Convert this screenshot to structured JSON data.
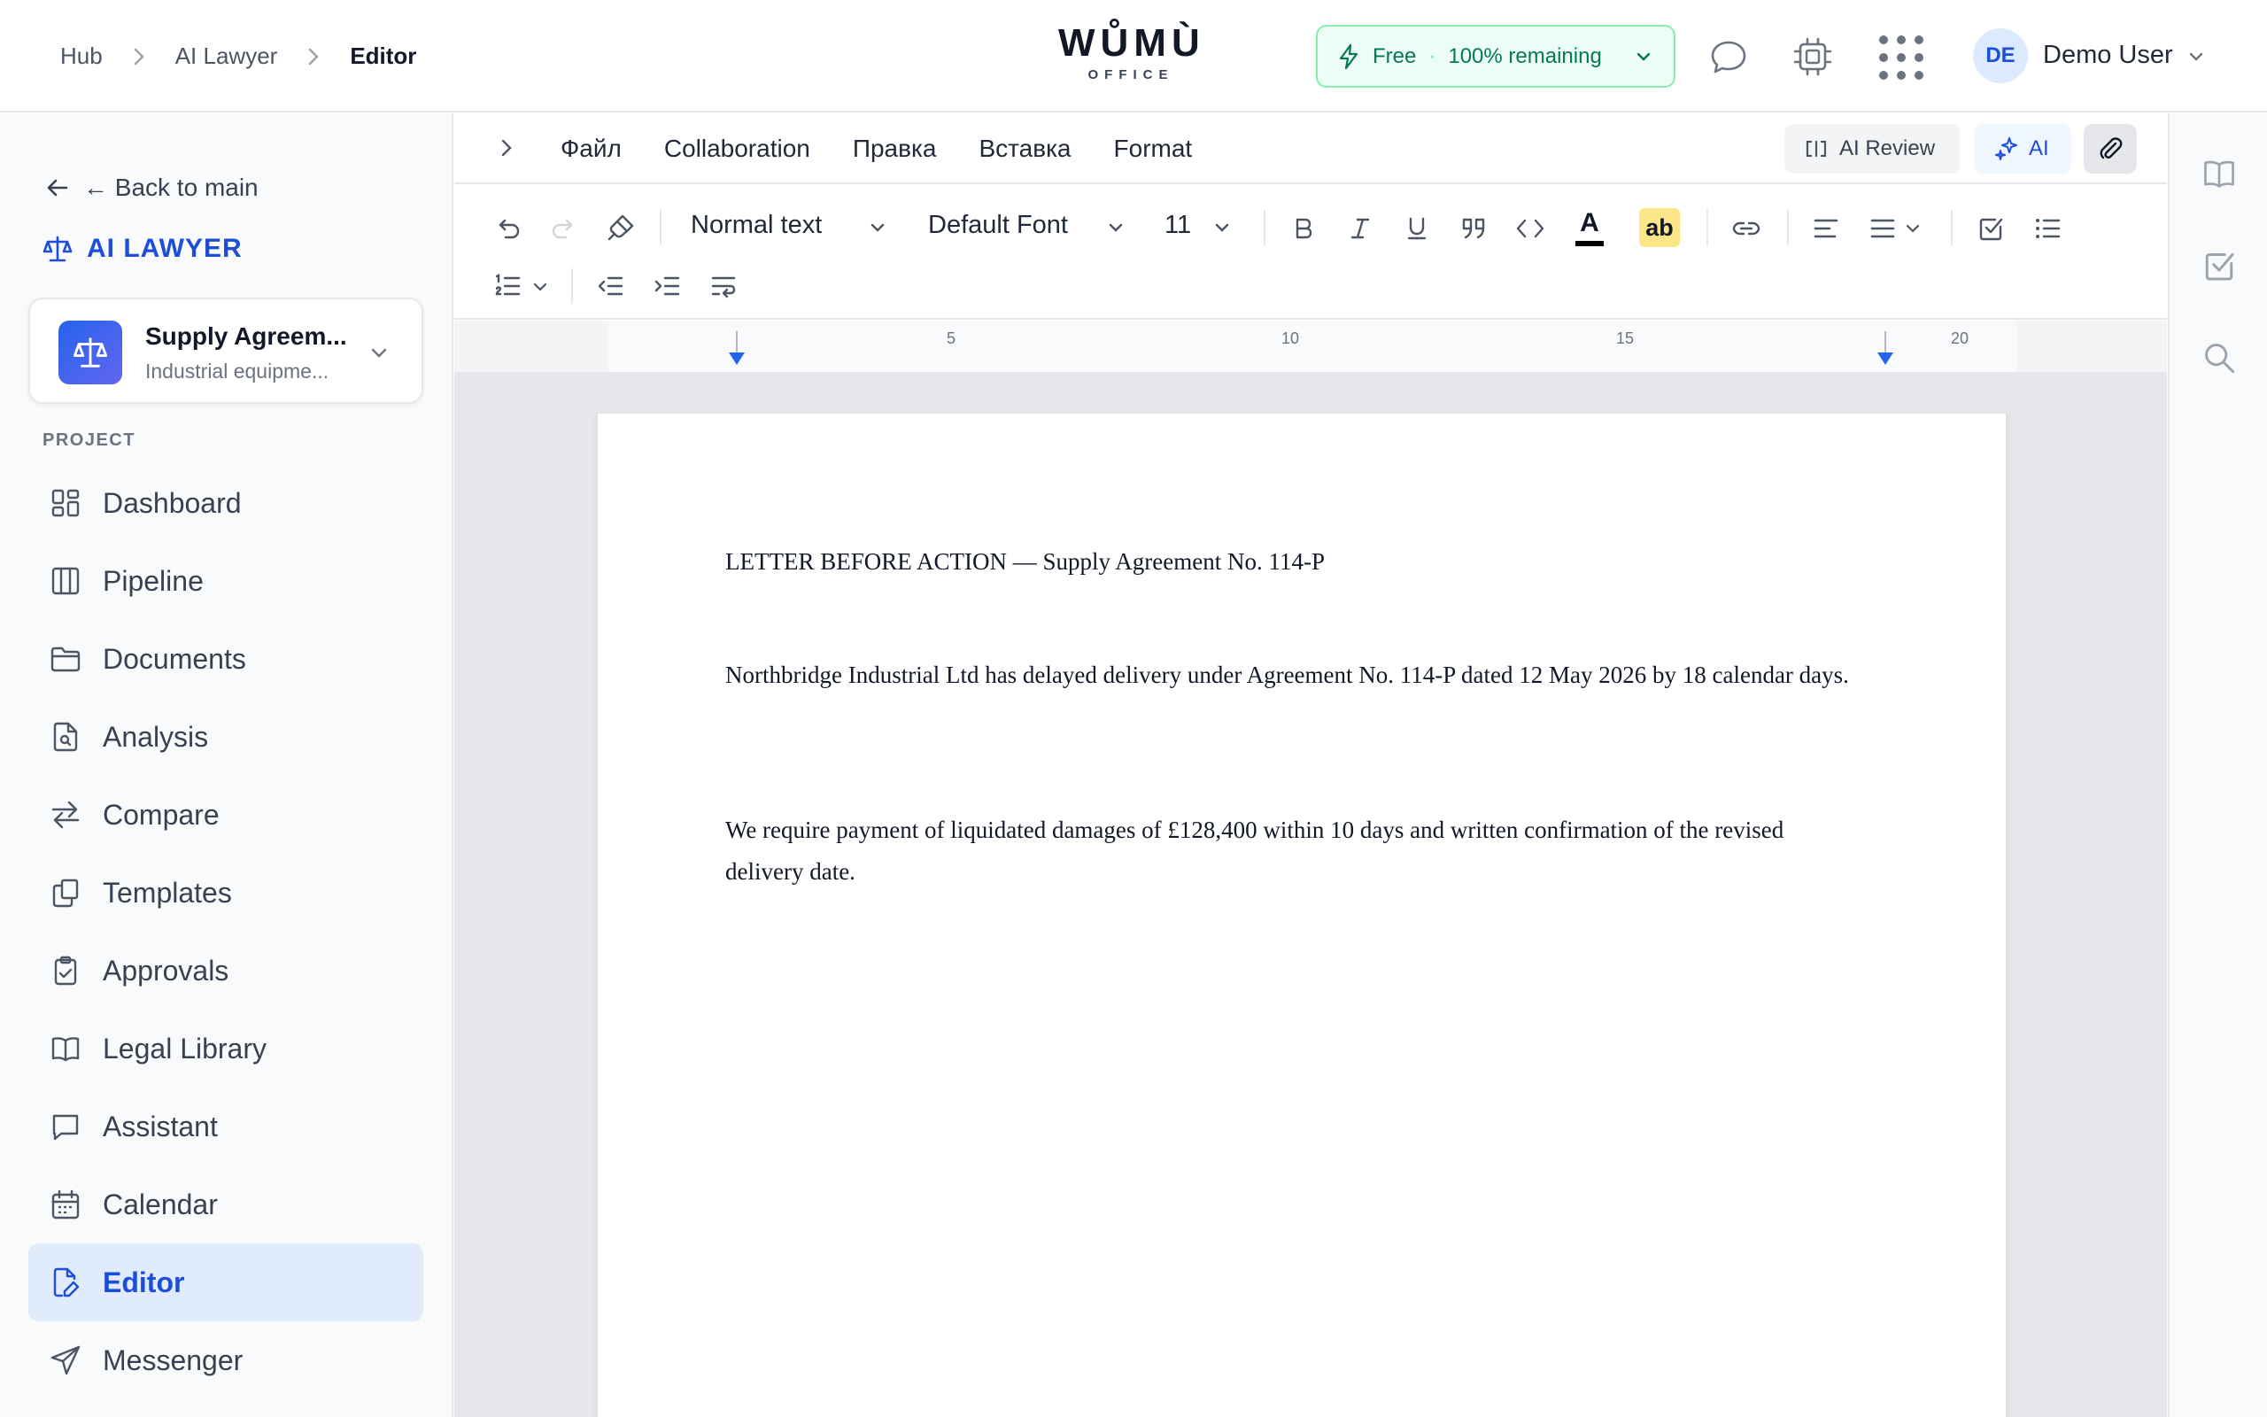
{
  "header": {
    "breadcrumbs": [
      "Hub",
      "AI Lawyer",
      "Editor"
    ],
    "logo": {
      "word": "WŮMÙ",
      "sub": "OFFICE"
    },
    "plan": {
      "name": "Free",
      "remaining": "100% remaining"
    },
    "user": {
      "initials": "DE",
      "name": "Demo User"
    }
  },
  "sidebar": {
    "back_label": "← Back to main",
    "brand": "AI LAWYER",
    "project": {
      "name": "Supply Agreem...",
      "description": "Industrial equipme..."
    },
    "section_label": "PROJECT",
    "items": [
      {
        "label": "Dashboard",
        "icon": "dashboard-icon"
      },
      {
        "label": "Pipeline",
        "icon": "pipeline-icon"
      },
      {
        "label": "Documents",
        "icon": "folder-icon"
      },
      {
        "label": "Analysis",
        "icon": "file-search-icon"
      },
      {
        "label": "Compare",
        "icon": "compare-arrows-icon"
      },
      {
        "label": "Templates",
        "icon": "templates-icon"
      },
      {
        "label": "Approvals",
        "icon": "clipboard-check-icon"
      },
      {
        "label": "Legal Library",
        "icon": "book-icon"
      },
      {
        "label": "Assistant",
        "icon": "chat-icon"
      },
      {
        "label": "Calendar",
        "icon": "calendar-icon"
      },
      {
        "label": "Editor",
        "icon": "edit-file-icon",
        "active": true
      },
      {
        "label": "Messenger",
        "icon": "send-icon"
      }
    ]
  },
  "menubar": {
    "menus": [
      "Файл",
      "Collaboration",
      "Правка",
      "Вставка",
      "Format"
    ],
    "ai_review": "AI Review",
    "ai": "AI"
  },
  "toolbar": {
    "block_type": "Normal text",
    "font": "Default Font",
    "font_size": "11",
    "highlight_label": "ab",
    "text_color_label": "A"
  },
  "ruler": {
    "ticks": [
      "5",
      "10",
      "15",
      "20"
    ]
  },
  "document": {
    "paragraphs": [
      "LETTER BEFORE ACTION — Supply Agreement No. 114-P",
      "Northbridge Industrial Ltd has delayed delivery under Agreement No. 114-P dated 12 May 2026 by 18 calendar days.",
      "We require payment of liquidated damages of £128,400 within 10 days and written confirmation of the revised delivery date."
    ]
  },
  "colors": {
    "accent": "#1d4ed8",
    "plan_bg": "#ecfdf5",
    "plan_text": "#047857",
    "active_nav": "#e0ecfb"
  }
}
